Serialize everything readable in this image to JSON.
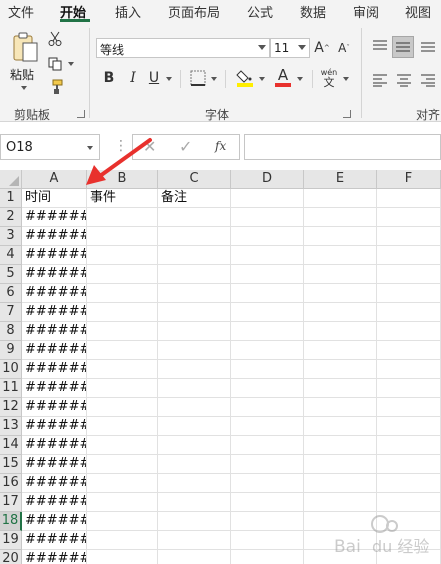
{
  "ribbon_tabs": [
    "文件",
    "开始",
    "插入",
    "页面布局",
    "公式",
    "数据",
    "审阅",
    "视图"
  ],
  "active_tab": "开始",
  "clipboard": {
    "paste_label": "粘贴",
    "group_label": "剪贴板"
  },
  "font": {
    "name": "等线",
    "size": "11",
    "group_label": "字体",
    "bold": "B",
    "italic": "I",
    "underline": "U",
    "wen": "wén",
    "wen2": "文"
  },
  "alignment": {
    "group_label": "对齐"
  },
  "formula_bar": {
    "name_box": "O18",
    "fx": "fx",
    "value": ""
  },
  "columns": [
    "A",
    "B",
    "C",
    "D",
    "E",
    "F"
  ],
  "rows": [
    "1",
    "2",
    "3",
    "4",
    "5",
    "6",
    "7",
    "8",
    "9",
    "10",
    "11",
    "12",
    "13",
    "14",
    "15",
    "16",
    "17",
    "18",
    "19",
    "20"
  ],
  "selected_row": "18",
  "header_row": [
    "时间",
    "事件",
    "备注"
  ],
  "col_a_value": "######",
  "accent": "#217346",
  "annotation_color": "#e8312d"
}
